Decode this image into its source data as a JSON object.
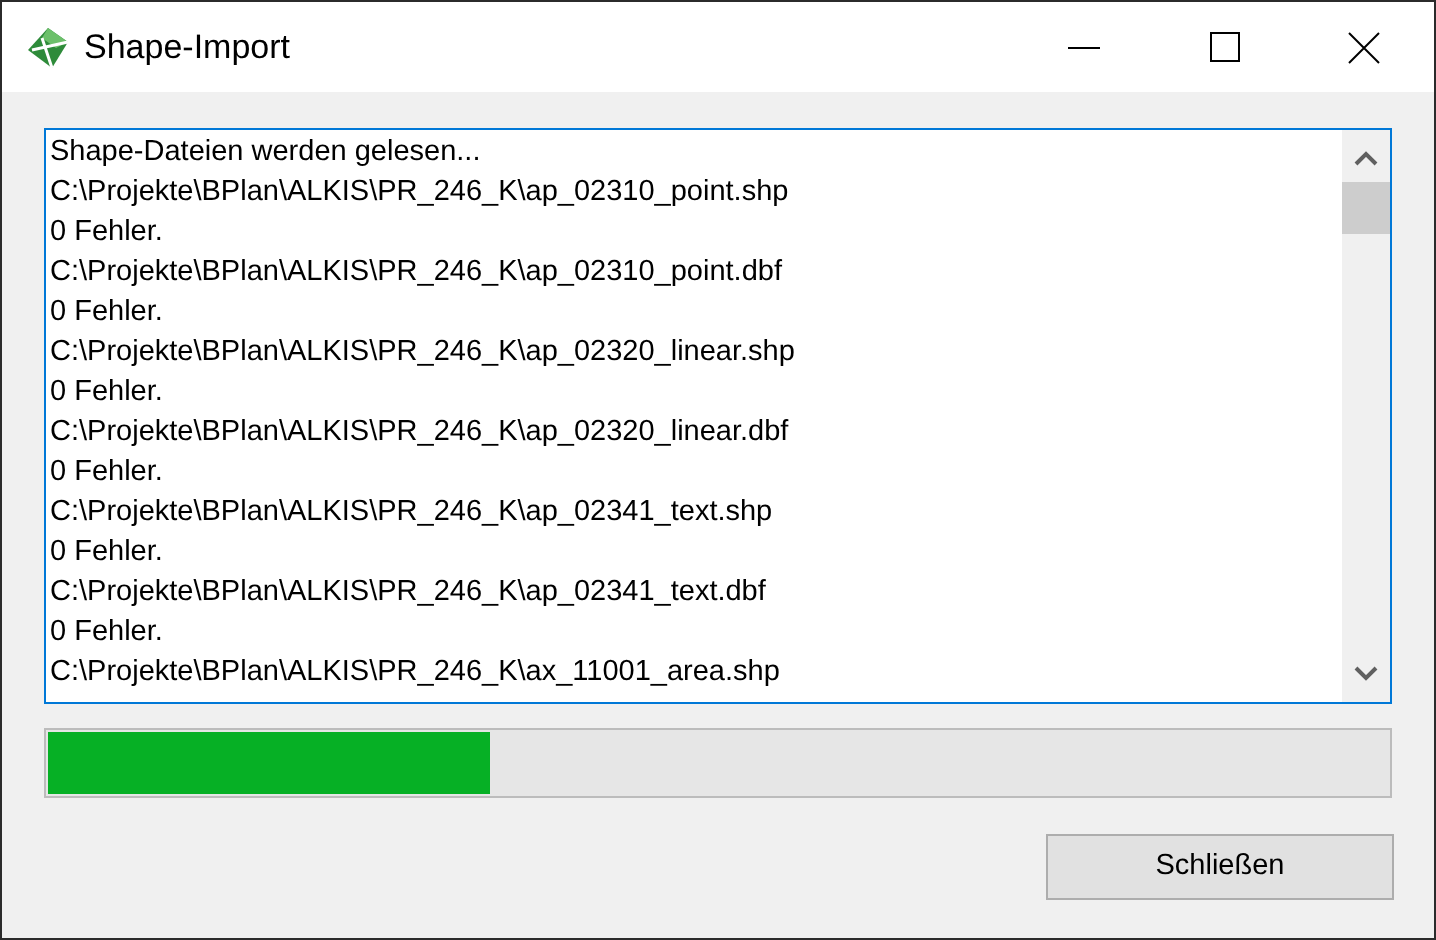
{
  "window": {
    "title": "Shape-Import"
  },
  "log": {
    "lines": [
      "Shape-Dateien werden gelesen...",
      "C:\\Projekte\\BPlan\\ALKIS\\PR_246_K\\ap_02310_point.shp",
      "0 Fehler.",
      "C:\\Projekte\\BPlan\\ALKIS\\PR_246_K\\ap_02310_point.dbf",
      "0 Fehler.",
      "C:\\Projekte\\BPlan\\ALKIS\\PR_246_K\\ap_02320_linear.shp",
      "0 Fehler.",
      "C:\\Projekte\\BPlan\\ALKIS\\PR_246_K\\ap_02320_linear.dbf",
      "0 Fehler.",
      "C:\\Projekte\\BPlan\\ALKIS\\PR_246_K\\ap_02341_text.shp",
      "0 Fehler.",
      "C:\\Projekte\\BPlan\\ALKIS\\PR_246_K\\ap_02341_text.dbf",
      "0 Fehler.",
      "C:\\Projekte\\BPlan\\ALKIS\\PR_246_K\\ax_11001_area.shp"
    ]
  },
  "progress": {
    "level": 0.33
  },
  "buttons": [
    "Schließen"
  ]
}
